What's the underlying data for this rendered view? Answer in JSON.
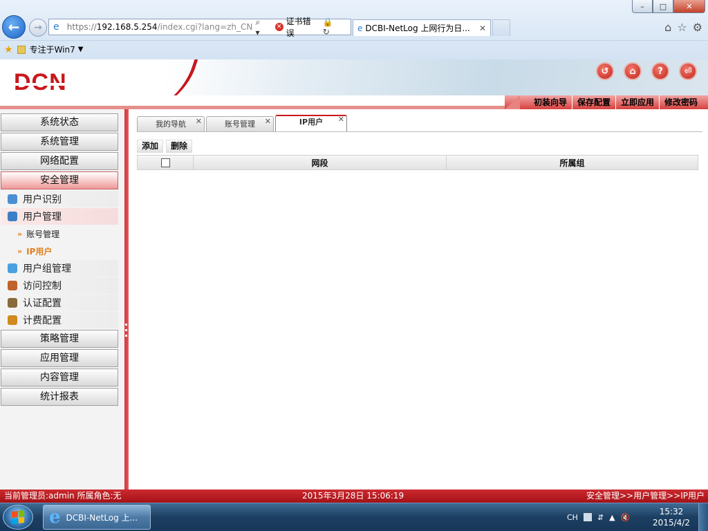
{
  "browser": {
    "address": {
      "scheme": "https://",
      "host": "192.168.5.254",
      "path": "/index.cgi?lang=zh_CN.U",
      "search_glyph": "⌕ ▾",
      "cert_error": "证书错误",
      "tools": "🔒 ↻"
    },
    "tab": {
      "title": "DCBI-NetLog 上网行为日...",
      "close": "✕"
    },
    "window_controls": {
      "minimize": "–",
      "maximize": "□",
      "close": "✕"
    },
    "right_tools": [
      "⌂",
      "☆",
      "⚙"
    ],
    "favorites": {
      "item": "专注于Win7"
    }
  },
  "app": {
    "logo": "DCN",
    "header_icons": [
      {
        "name": "logout-icon",
        "glyph": "↺"
      },
      {
        "name": "home-icon",
        "glyph": "⌂"
      },
      {
        "name": "help-icon",
        "glyph": "?"
      },
      {
        "name": "exit-icon",
        "glyph": "⏎"
      }
    ],
    "quick_links": [
      "初装向导",
      "保存配置",
      "立即应用",
      "修改密码"
    ]
  },
  "sidebar": {
    "top_menus": [
      "系统状态",
      "系统管理",
      "网络配置",
      "安全管理"
    ],
    "security_subs": [
      {
        "label": "用户识别",
        "icon": "user-identify-icon",
        "color": "#4a8fd4"
      },
      {
        "label": "用户管理",
        "icon": "user-manage-icon",
        "color": "#3a7fc8"
      }
    ],
    "user_manage_subs": [
      "账号管理",
      "IP用户"
    ],
    "more_subs": [
      {
        "label": "用户组管理",
        "icon": "user-group-icon",
        "color": "#4aa0e0"
      },
      {
        "label": "访问控制",
        "icon": "access-control-icon",
        "color": "#c0622a"
      },
      {
        "label": "认证配置",
        "icon": "auth-config-icon",
        "color": "#8a6a3a"
      },
      {
        "label": "计费配置",
        "icon": "billing-config-icon",
        "color": "#d08a20"
      }
    ],
    "bottom_menus": [
      "策略管理",
      "应用管理",
      "内容管理",
      "统计报表"
    ]
  },
  "main": {
    "tabs": [
      {
        "label": "我的导航",
        "close": "✕"
      },
      {
        "label": "账号管理",
        "close": "✕"
      },
      {
        "label": "IP用户",
        "close": "✕"
      }
    ],
    "actions": {
      "add": "添加",
      "delete": "删除"
    },
    "grid": {
      "columns": [
        "网段",
        "所属组"
      ]
    }
  },
  "statusbar": {
    "left": "当前管理员:admin  所属角色:无",
    "center": "2015年3月28日 15:06:19",
    "right": "安全管理>>用户管理>>IP用户"
  },
  "taskbar": {
    "app_label": "DCBI-NetLog 上...",
    "tray_lang": "CH",
    "clock_time": "15:32",
    "clock_date": "2015/4/2"
  }
}
